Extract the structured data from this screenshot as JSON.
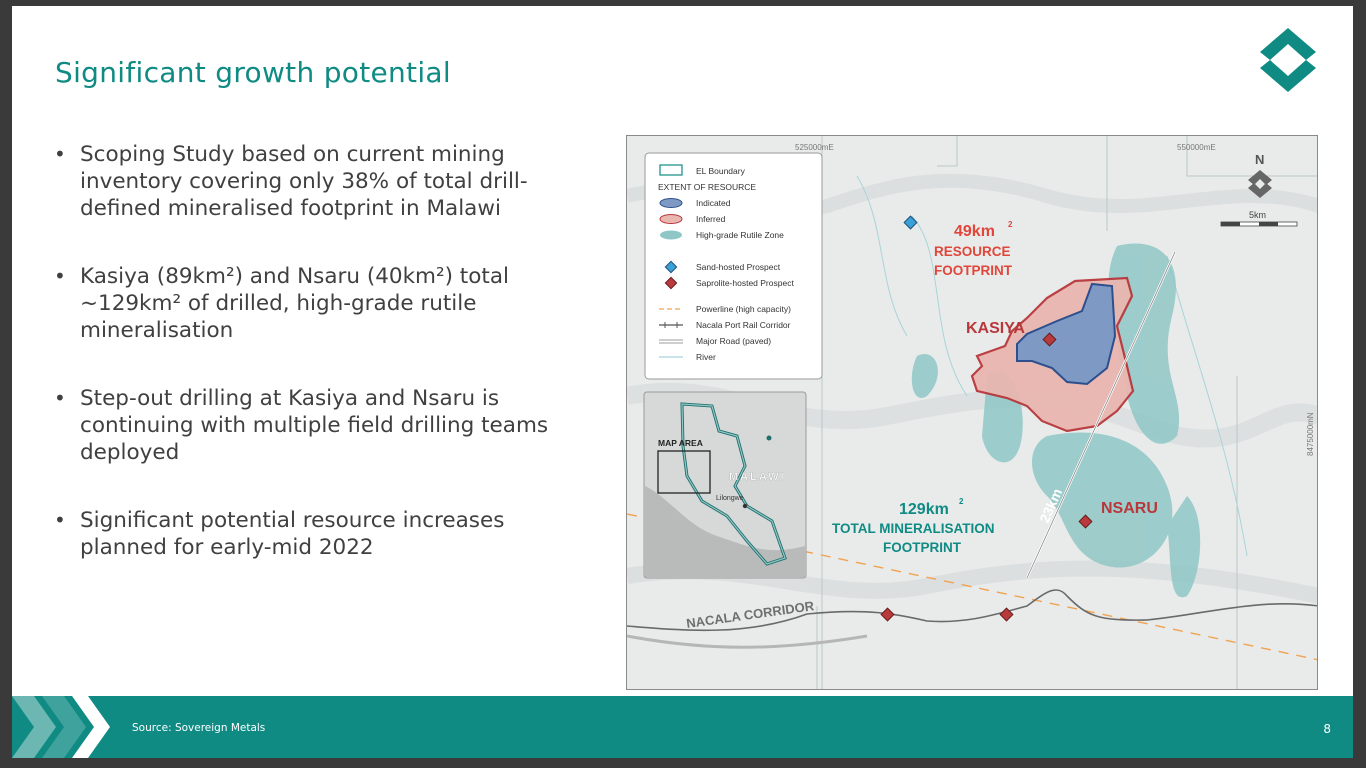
{
  "slide": {
    "title": "Significant growth potential",
    "bullets": [
      "Scoping Study based on current mining inventory covering only 38% of total drill-defined mineralised footprint in Malawi",
      "Kasiya (89km²) and Nsaru (40km²) total ~129km² of drilled, high-grade rutile mineralisation",
      "Step-out drilling at Kasiya and Nsaru is continuing with multiple field drilling teams deployed",
      "Significant potential resource increases planned for early-mid 2022"
    ]
  },
  "map": {
    "grid_labels": {
      "top_left": "525000mE",
      "top_right": "550000mE",
      "right_side": "8475000mN"
    },
    "north": "N",
    "scale": "5km",
    "legend": {
      "el_boundary": "EL Boundary",
      "extent_heading": "EXTENT OF RESOURCE",
      "indicated": "Indicated",
      "inferred": "Inferred",
      "high_grade": "High-grade Rutile Zone",
      "sand_prospect": "Sand-hosted Prospect",
      "saprolite_prospect": "Saprolite-hosted Prospect",
      "powerline": "Powerline (high capacity)",
      "rail": "Nacala Port Rail Corridor",
      "road": "Major Road (paved)",
      "river": "River"
    },
    "inset": {
      "map_area": "MAP AREA",
      "country": "MALAWI",
      "city": "Lilongwe"
    },
    "resource": {
      "area": "49km",
      "sup": "2",
      "line1": "RESOURCE",
      "line2": "FOOTPRINT"
    },
    "kasiya": "KASIYA",
    "nsaru": "NSARU",
    "distance": "23km",
    "total": {
      "area": "129km",
      "sup": "2",
      "line1": "TOTAL MINERALISATION",
      "line2": "FOOTPRINT"
    },
    "corridor": "NACALA CORRIDOR"
  },
  "footer": {
    "source": "Source: Sovereign Metals",
    "page": "8"
  },
  "colors": {
    "teal": "#0f8b84",
    "red_label": "#e0463a",
    "indicated": "#4a6fa8",
    "inferred": "#e9a7a0"
  }
}
